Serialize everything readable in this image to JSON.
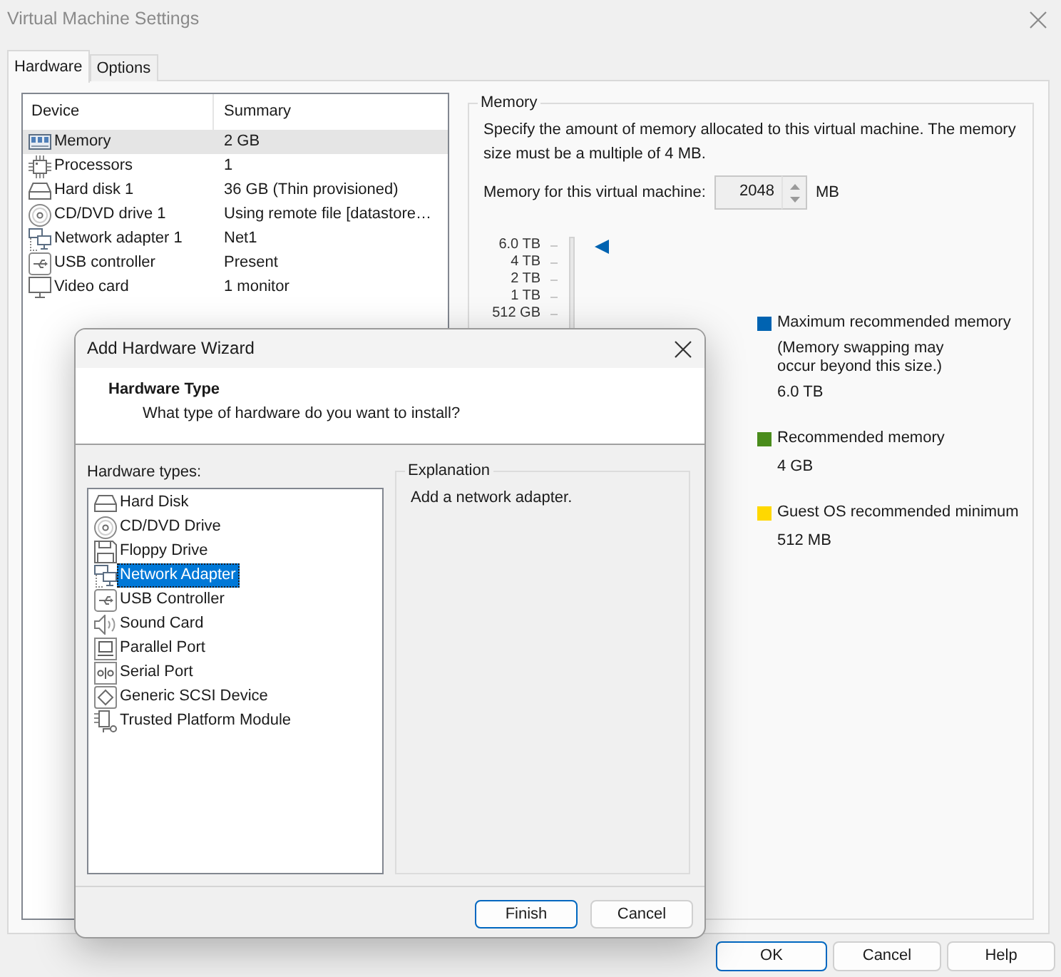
{
  "window": {
    "title": "Virtual Machine Settings"
  },
  "tabs": [
    {
      "label": "Hardware",
      "selected": true
    },
    {
      "label": "Options",
      "selected": false
    }
  ],
  "device_table": {
    "columns": [
      "Device",
      "Summary"
    ],
    "rows": [
      {
        "kind": "memory",
        "device": "Memory",
        "summary": "2 GB",
        "selected": true
      },
      {
        "kind": "processor",
        "device": "Processors",
        "summary": "1",
        "selected": false
      },
      {
        "kind": "hard-disk",
        "device": "Hard disk 1",
        "summary": "36 GB (Thin provisioned)",
        "selected": false
      },
      {
        "kind": "cd-dvd",
        "device": "CD/DVD drive 1",
        "summary": "Using remote file [datastore…",
        "selected": false
      },
      {
        "kind": "network",
        "device": "Network adapter 1",
        "summary": "Net1",
        "selected": false
      },
      {
        "kind": "usb",
        "device": "USB controller",
        "summary": "Present",
        "selected": false
      },
      {
        "kind": "video",
        "device": "Video card",
        "summary": "1 monitor",
        "selected": false
      }
    ]
  },
  "memory": {
    "legend": "Memory",
    "description": "Specify the amount of memory allocated to this virtual machine. The memory size must be a multiple of 4 MB.",
    "field_label": "Memory for this virtual machine:",
    "value": "2048",
    "unit": "MB",
    "scale_labels": [
      "6.0 TB",
      "4 TB",
      "2 TB",
      "1 TB",
      "512 GB"
    ],
    "legend_items": [
      {
        "label": "Maximum recommended memory",
        "note": "(Memory swapping may occur beyond this size.)",
        "value": "6.0 TB",
        "color": "#0063b1"
      },
      {
        "label": "Recommended memory",
        "value": "4 GB",
        "color": "#4a8c1c"
      },
      {
        "label": "Guest OS recommended minimum",
        "value": "512 MB",
        "color": "#ffd800"
      }
    ]
  },
  "buttons": [
    {
      "label": "OK",
      "default": true
    },
    {
      "label": "Cancel",
      "default": false
    },
    {
      "label": "Help",
      "default": false
    }
  ],
  "wizard": {
    "title": "Add Hardware Wizard",
    "heading": "Hardware Type",
    "subheading": "What type of hardware do you want to install?",
    "list_label": "Hardware types:",
    "hardware_types": [
      {
        "kind": "hard-disk",
        "label": "Hard Disk",
        "selected": false
      },
      {
        "kind": "cd-dvd",
        "label": "CD/DVD Drive",
        "selected": false
      },
      {
        "kind": "floppy",
        "label": "Floppy Drive",
        "selected": false
      },
      {
        "kind": "network",
        "label": "Network Adapter",
        "selected": true
      },
      {
        "kind": "usb",
        "label": "USB Controller",
        "selected": false
      },
      {
        "kind": "sound",
        "label": "Sound Card",
        "selected": false
      },
      {
        "kind": "parallel",
        "label": "Parallel Port",
        "selected": false
      },
      {
        "kind": "serial",
        "label": "Serial Port",
        "selected": false
      },
      {
        "kind": "scsi",
        "label": "Generic SCSI Device",
        "selected": false
      },
      {
        "kind": "tpm",
        "label": "Trusted Platform Module",
        "selected": false
      }
    ],
    "explanation_legend": "Explanation",
    "explanation": "Add a network adapter.",
    "buttons": [
      {
        "label": "Finish",
        "default": true
      },
      {
        "label": "Cancel",
        "default": false
      }
    ]
  }
}
